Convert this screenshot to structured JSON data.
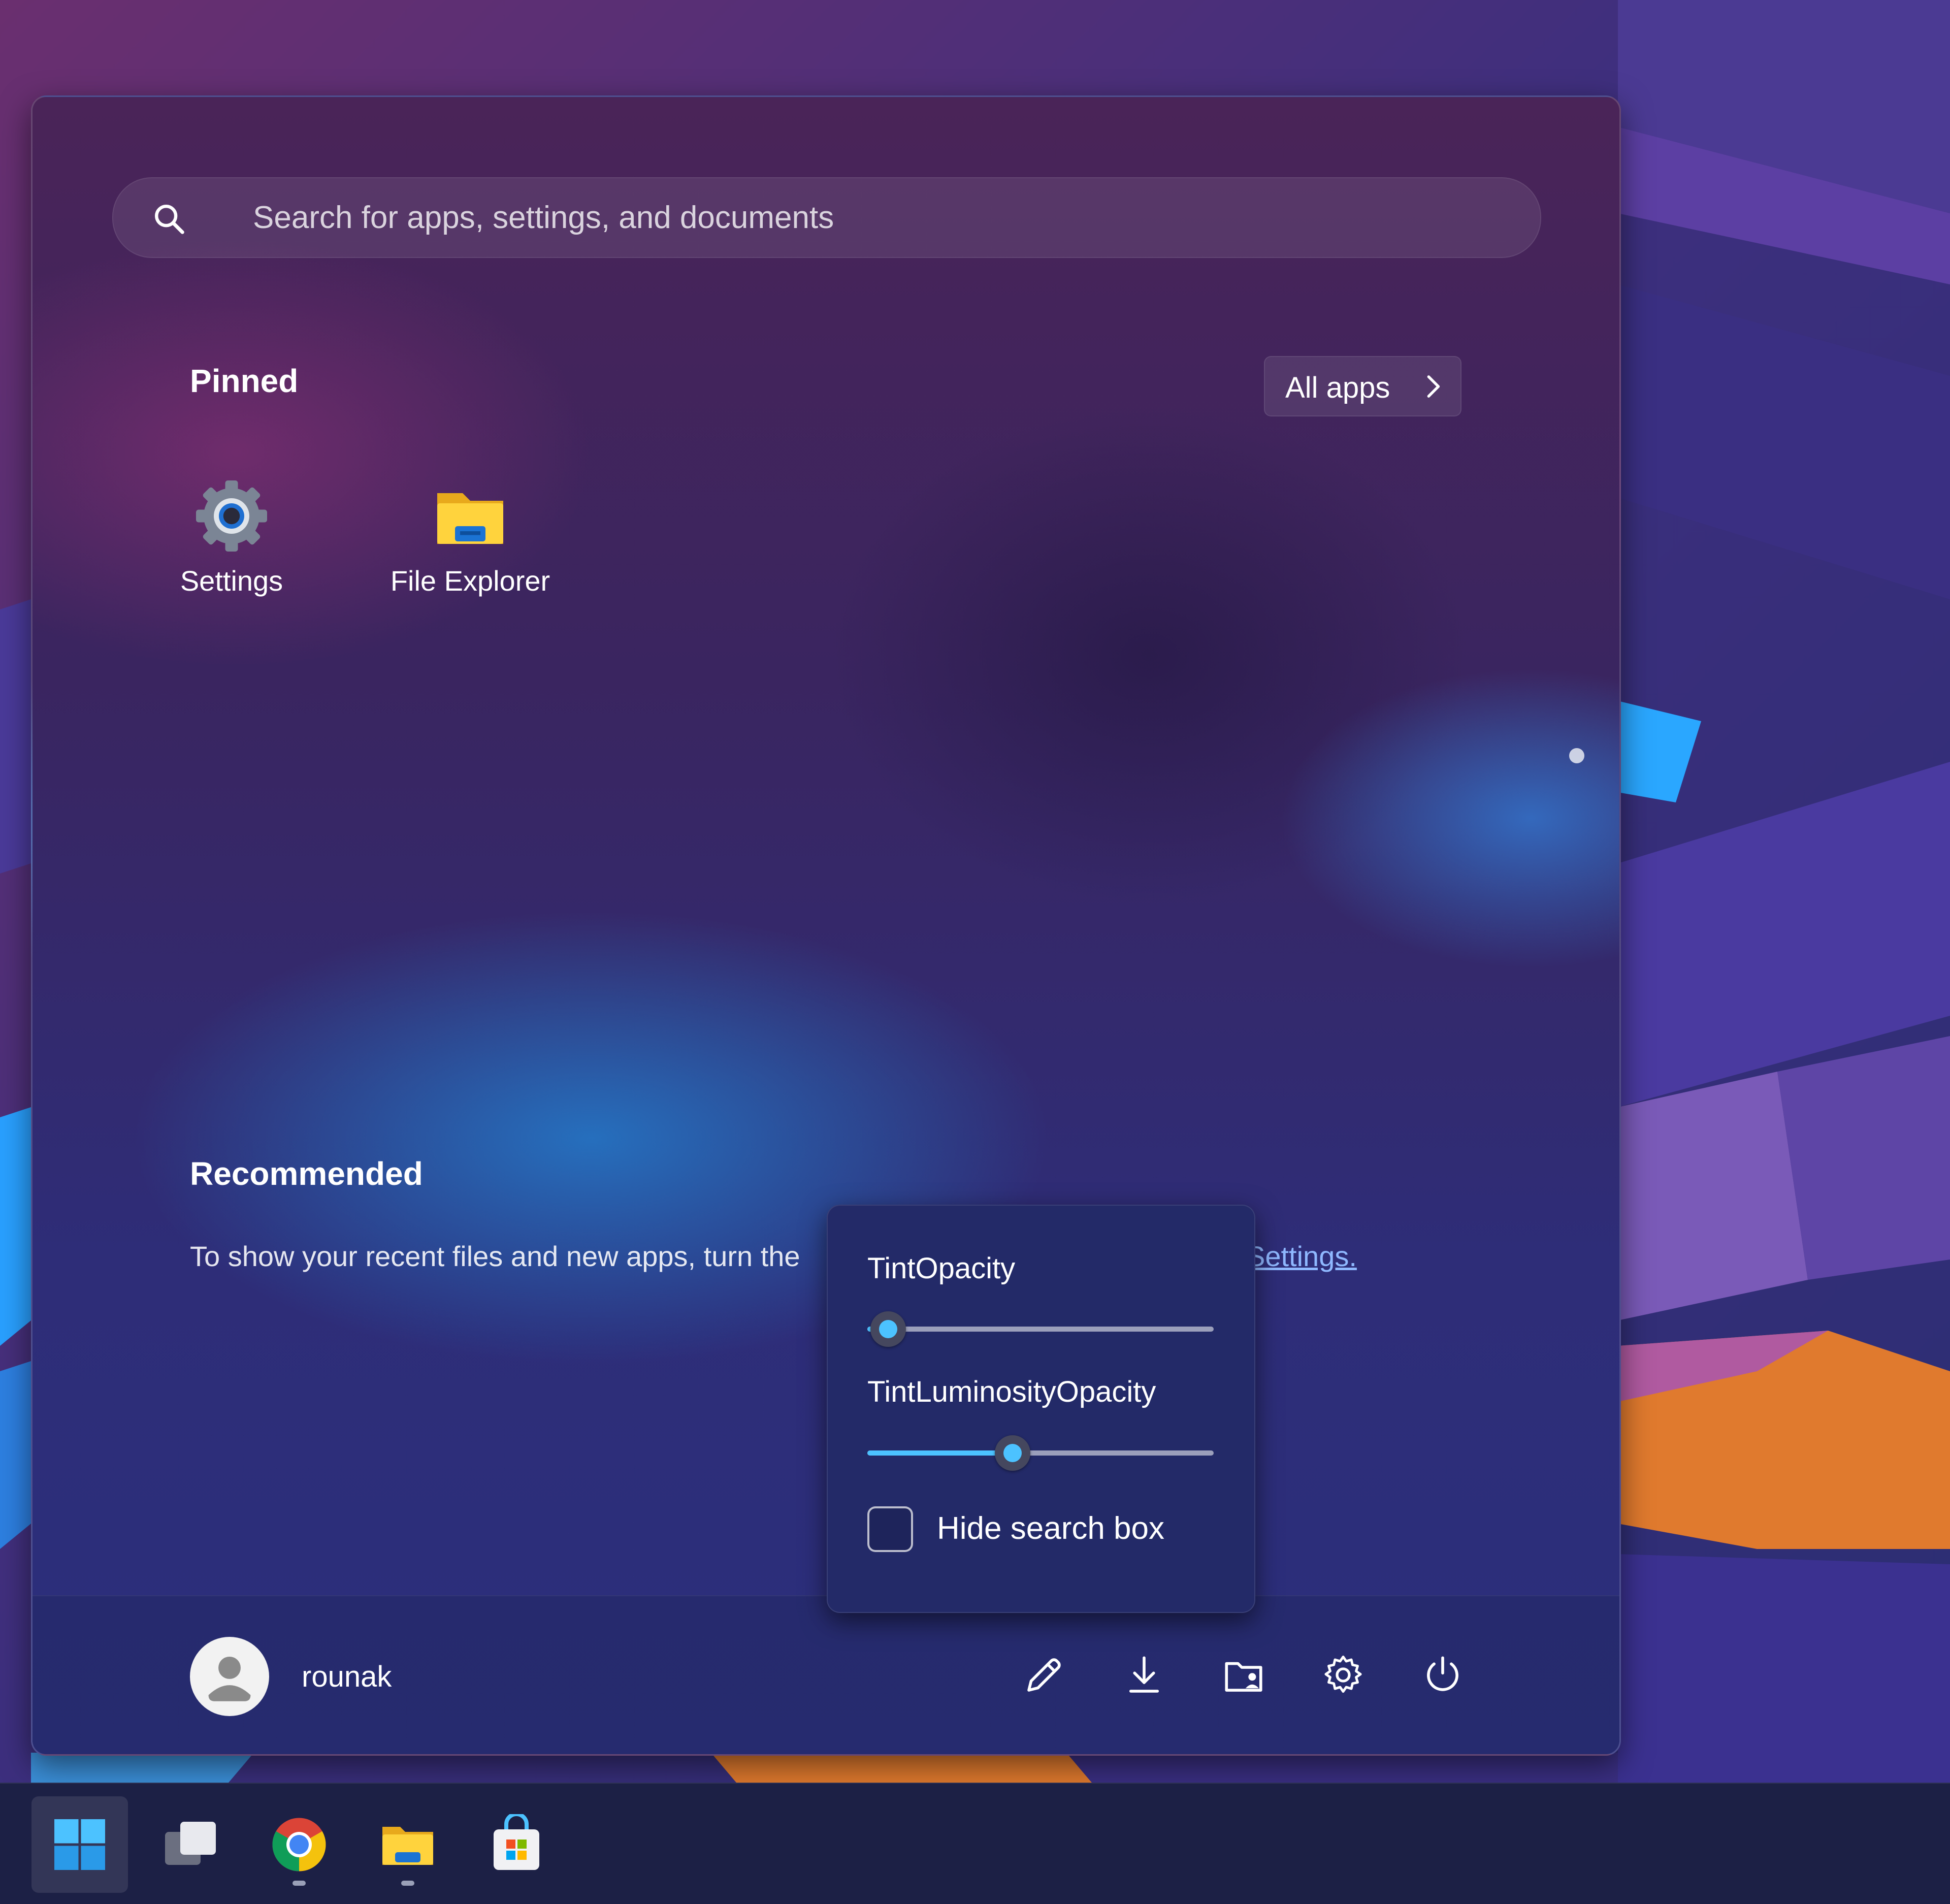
{
  "search": {
    "placeholder": "Search for apps, settings, and documents"
  },
  "pinned": {
    "title": "Pinned",
    "all_apps_label": "All apps",
    "apps": [
      {
        "label": "Settings",
        "icon": "settings-gear-icon"
      },
      {
        "label": "File Explorer",
        "icon": "folder-icon"
      }
    ]
  },
  "recommended": {
    "title": "Recommended",
    "message": "To show your recent files and new apps, turn the",
    "link_text": "Settings."
  },
  "user": {
    "name": "rounak"
  },
  "footer_buttons": [
    "edit-icon",
    "downloads-icon",
    "personal-folder-icon",
    "settings-icon",
    "power-icon"
  ],
  "tint_panel": {
    "tint_opacity_label": "TintOpacity",
    "tint_opacity_value": 0.06,
    "tint_luminosity_label": "TintLuminosityOpacity",
    "tint_luminosity_value": 0.42,
    "hide_search_label": "Hide search box",
    "hide_search_checked": false
  },
  "taskbar": {
    "items": [
      "start-icon",
      "task-view-icon",
      "chrome-icon",
      "file-explorer-icon",
      "store-icon"
    ]
  },
  "colors": {
    "accent": "#4cc2ff",
    "link": "#8fb8ff"
  }
}
